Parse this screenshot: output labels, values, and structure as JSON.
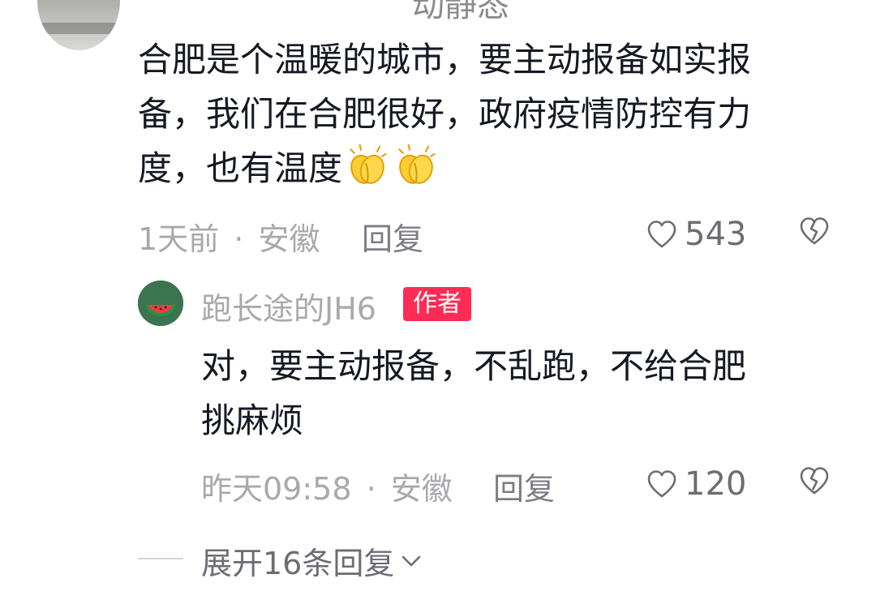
{
  "top": {
    "username_partial": "动静态"
  },
  "comment": {
    "text_line1": "合肥是个温暖的城市，要主动报备如实报",
    "text_line2": "备，我们在合肥很好，政府疫情防控有力",
    "text_line3": "度，也有温度",
    "emoji": [
      "clapping-hands",
      "clapping-hands"
    ],
    "time": "1天前",
    "separator": "·",
    "location": "安徽",
    "reply_label": "回复",
    "like_count": "543"
  },
  "reply": {
    "username": "跑长途的JH6",
    "badge": "作者",
    "text_line1": "对，要主动报备，不乱跑，不给合肥",
    "text_line2": "挑麻烦",
    "time": "昨天09:58",
    "separator": "·",
    "location": "安徽",
    "reply_label": "回复",
    "like_count": "120"
  },
  "expand": {
    "label": "展开16条回复"
  },
  "colors": {
    "text": "#161823",
    "meta": "#a8a9ae",
    "badge": "#fe2c55"
  },
  "icons": {
    "like": "heart-outline-icon",
    "dislike": "broken-heart-icon",
    "expand": "chevron-down-icon"
  }
}
